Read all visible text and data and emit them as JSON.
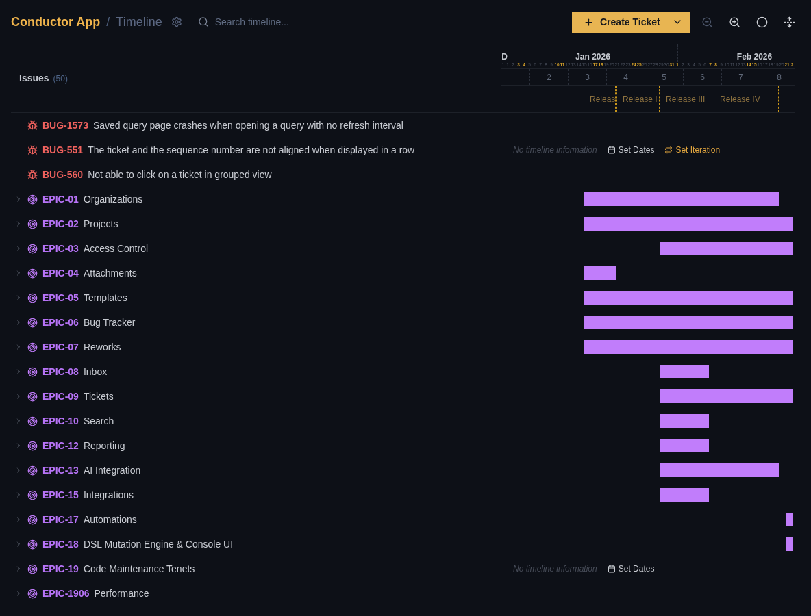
{
  "header": {
    "app_title": "Conductor App",
    "separator": "/",
    "page_title": "Timeline",
    "search": {
      "placeholder": "Search timeline..."
    },
    "create_button": {
      "label": "Create Ticket"
    },
    "view_controls": [
      {
        "kind": "zoom_out",
        "disabled": true
      },
      {
        "kind": "zoom_in",
        "disabled": false
      },
      {
        "kind": "circle",
        "disabled": false
      },
      {
        "kind": "unfold",
        "disabled": false
      }
    ]
  },
  "issues_header": {
    "title": "Issues",
    "count": "(50)"
  },
  "timeline": {
    "months": [
      {
        "label": "D",
        "days": [
          {
            "label": "1",
            "weekend": false
          }
        ]
      },
      {
        "label": "Jan 2026",
        "days": [
          {
            "label": "1",
            "weekend": false
          },
          {
            "label": "2",
            "weekend": false
          },
          {
            "label": "3",
            "weekend": true
          },
          {
            "label": "4",
            "weekend": true
          },
          {
            "label": "5",
            "weekend": false
          },
          {
            "label": "6",
            "weekend": false
          },
          {
            "label": "7",
            "weekend": false
          },
          {
            "label": "8",
            "weekend": false
          },
          {
            "label": "9",
            "weekend": false
          },
          {
            "label": "10",
            "weekend": true
          },
          {
            "label": "11",
            "weekend": true
          },
          {
            "label": "12",
            "weekend": false
          },
          {
            "label": "13",
            "weekend": false
          },
          {
            "label": "14",
            "weekend": false
          },
          {
            "label": "15",
            "weekend": false
          },
          {
            "label": "16",
            "weekend": false
          },
          {
            "label": "17",
            "weekend": true
          },
          {
            "label": "18",
            "weekend": true
          },
          {
            "label": "19",
            "weekend": false
          },
          {
            "label": "20",
            "weekend": false
          },
          {
            "label": "21",
            "weekend": false
          },
          {
            "label": "22",
            "weekend": false
          },
          {
            "label": "23",
            "weekend": false
          },
          {
            "label": "24",
            "weekend": true
          },
          {
            "label": "25",
            "weekend": true
          },
          {
            "label": "26",
            "weekend": false
          },
          {
            "label": "27",
            "weekend": false
          },
          {
            "label": "28",
            "weekend": false
          },
          {
            "label": "29",
            "weekend": false
          },
          {
            "label": "30",
            "weekend": false
          },
          {
            "label": "31",
            "weekend": true
          }
        ]
      },
      {
        "label": "Feb 2026",
        "days": [
          {
            "label": "1",
            "weekend": true
          },
          {
            "label": "2",
            "weekend": false
          },
          {
            "label": "3",
            "weekend": false
          },
          {
            "label": "4",
            "weekend": false
          },
          {
            "label": "5",
            "weekend": false
          },
          {
            "label": "6",
            "weekend": false
          },
          {
            "label": "7",
            "weekend": true
          },
          {
            "label": "8",
            "weekend": true
          },
          {
            "label": "9",
            "weekend": false
          },
          {
            "label": "10",
            "weekend": false
          },
          {
            "label": "11",
            "weekend": false
          },
          {
            "label": "12",
            "weekend": false
          },
          {
            "label": "13",
            "weekend": false
          },
          {
            "label": "14",
            "weekend": true
          },
          {
            "label": "15",
            "weekend": true
          },
          {
            "label": "16",
            "weekend": false
          },
          {
            "label": "17",
            "weekend": false
          },
          {
            "label": "18",
            "weekend": false
          },
          {
            "label": "19",
            "weekend": false
          },
          {
            "label": "20",
            "weekend": false
          },
          {
            "label": "21",
            "weekend": true
          },
          {
            "label": "2",
            "weekend": true
          }
        ]
      }
    ],
    "weeks": [
      "2",
      "3",
      "4",
      "5",
      "6",
      "7",
      "8"
    ],
    "releases": [
      {
        "kind": "release",
        "label": "Releas"
      },
      {
        "kind": "release",
        "label": "Release I"
      },
      {
        "kind": "release",
        "label": "Release III"
      },
      {
        "kind": "release",
        "label": "Release IV"
      },
      {
        "kind": "marker"
      }
    ]
  },
  "rows": [
    {
      "kind": "bug",
      "id": "BUG-1573",
      "title": "Saved query page crashes when opening a query with no refresh interval"
    },
    {
      "kind": "bug",
      "id": "BUG-551",
      "title": "The ticket and the sequence number are not aligned when displayed in a row",
      "timeline": {
        "kind": "unscheduled",
        "message": "No timeline information",
        "actions": [
          {
            "kind": "dates",
            "label": "Set Dates"
          },
          {
            "kind": "iteration",
            "label": "Set Iteration"
          }
        ]
      }
    },
    {
      "kind": "bug",
      "id": "BUG-560",
      "title": "Not able to click on a ticket in grouped view"
    },
    {
      "kind": "epic",
      "id": "EPIC-01",
      "title": "Organizations",
      "expanded": false,
      "timeline": {
        "kind": "bar"
      }
    },
    {
      "kind": "epic",
      "id": "EPIC-02",
      "title": "Projects",
      "expanded": false,
      "timeline": {
        "kind": "bar"
      }
    },
    {
      "kind": "epic",
      "id": "EPIC-03",
      "title": "Access Control",
      "expanded": false,
      "timeline": {
        "kind": "bar"
      }
    },
    {
      "kind": "epic",
      "id": "EPIC-04",
      "title": "Attachments",
      "expanded": false,
      "timeline": {
        "kind": "bar"
      }
    },
    {
      "kind": "epic",
      "id": "EPIC-05",
      "title": "Templates",
      "expanded": false,
      "timeline": {
        "kind": "bar"
      }
    },
    {
      "kind": "epic",
      "id": "EPIC-06",
      "title": "Bug Tracker",
      "expanded": false,
      "timeline": {
        "kind": "bar"
      }
    },
    {
      "kind": "epic",
      "id": "EPIC-07",
      "title": "Reworks",
      "expanded": false,
      "timeline": {
        "kind": "bar"
      }
    },
    {
      "kind": "epic",
      "id": "EPIC-08",
      "title": "Inbox",
      "expanded": false,
      "timeline": {
        "kind": "bar"
      }
    },
    {
      "kind": "epic",
      "id": "EPIC-09",
      "title": "Tickets",
      "expanded": false,
      "timeline": {
        "kind": "bar"
      }
    },
    {
      "kind": "epic",
      "id": "EPIC-10",
      "title": "Search",
      "expanded": false,
      "timeline": {
        "kind": "bar"
      }
    },
    {
      "kind": "epic",
      "id": "EPIC-12",
      "title": "Reporting",
      "expanded": false,
      "timeline": {
        "kind": "bar"
      }
    },
    {
      "kind": "epic",
      "id": "EPIC-13",
      "title": "AI Integration",
      "expanded": false,
      "timeline": {
        "kind": "bar"
      }
    },
    {
      "kind": "epic",
      "id": "EPIC-15",
      "title": "Integrations",
      "expanded": false,
      "timeline": {
        "kind": "bar"
      }
    },
    {
      "kind": "epic",
      "id": "EPIC-17",
      "title": "Automations",
      "expanded": false,
      "timeline": {
        "kind": "bar"
      }
    },
    {
      "kind": "epic",
      "id": "EPIC-18",
      "title": "DSL Mutation Engine & Console UI",
      "expanded": false,
      "timeline": {
        "kind": "bar"
      }
    },
    {
      "kind": "epic",
      "id": "EPIC-19",
      "title": "Code Maintenance Tenets",
      "expanded": false,
      "timeline": {
        "kind": "unscheduled",
        "message": "No timeline information",
        "actions": [
          {
            "kind": "dates",
            "label": "Set Dates"
          }
        ]
      }
    },
    {
      "kind": "epic",
      "id": "EPIC-1906",
      "title": "Performance",
      "expanded": false
    }
  ]
}
